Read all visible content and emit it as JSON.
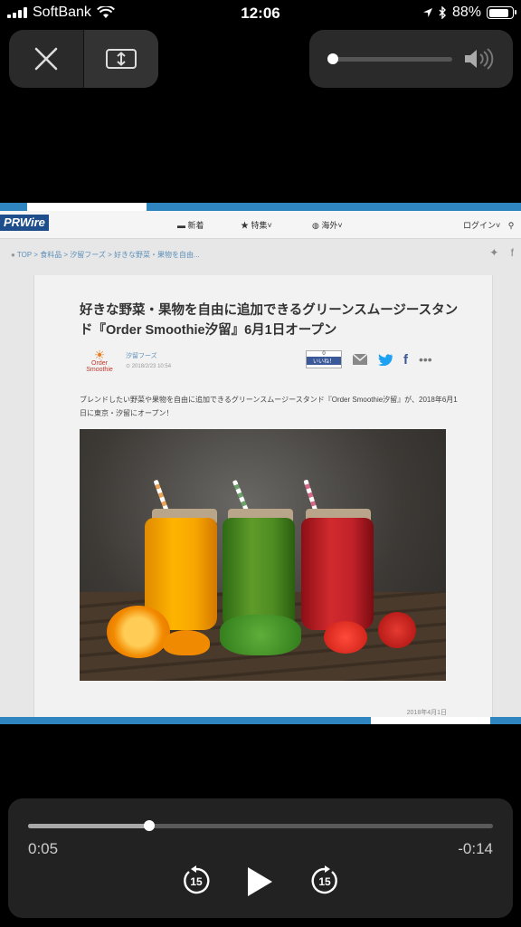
{
  "status_bar": {
    "carrier": "SoftBank",
    "time": "12:06",
    "battery": "88%",
    "battery_level": 0.88,
    "icons": [
      "signal-icon",
      "wifi-icon",
      "location-icon",
      "bluetooth-icon",
      "battery-icon"
    ]
  },
  "top_controls": {
    "close_icon": "close-icon",
    "resize_icon": "resize-icon",
    "volume_level": 0,
    "volume_icon": "speaker-icon"
  },
  "video_frame": {
    "site": {
      "logo": "PRWire",
      "nav": [
        {
          "label": "新着",
          "icon": "newspaper-icon"
        },
        {
          "label": "特集",
          "icon": "star-icon"
        },
        {
          "label": "海外",
          "icon": "globe-icon"
        }
      ],
      "login": "ログイン"
    },
    "breadcrumb": "TOP > 食料品 > 汐留フーズ > 好きな野菜・果物を自由...",
    "article": {
      "title": "好きな野菜・果物を自由に追加できるグリーンスムージースタンド『Order Smoothie汐留』6月1日オープン",
      "brand_logo_text": "Order Smoothie",
      "brand_name": "汐留フーズ",
      "brand_date": "2018/2/23 10:54",
      "like_count": "0",
      "like_label": "いいね！",
      "lead": "ブレンドしたい野菜や果物を自由に追加できるグリーンスムージースタンド『Order Smoothie汐留』が、2018年6月1日に東京・汐留にオープン！",
      "footer_date": "2018年4月1日"
    }
  },
  "player": {
    "elapsed": "0:05",
    "remaining": "-0:14",
    "progress": 0.26,
    "skip_back_label": "15",
    "skip_forward_label": "15"
  },
  "colors": {
    "accent_blue": "#2f85bf",
    "pill_bg": "#2a2a2a",
    "player_bg": "#222222"
  }
}
